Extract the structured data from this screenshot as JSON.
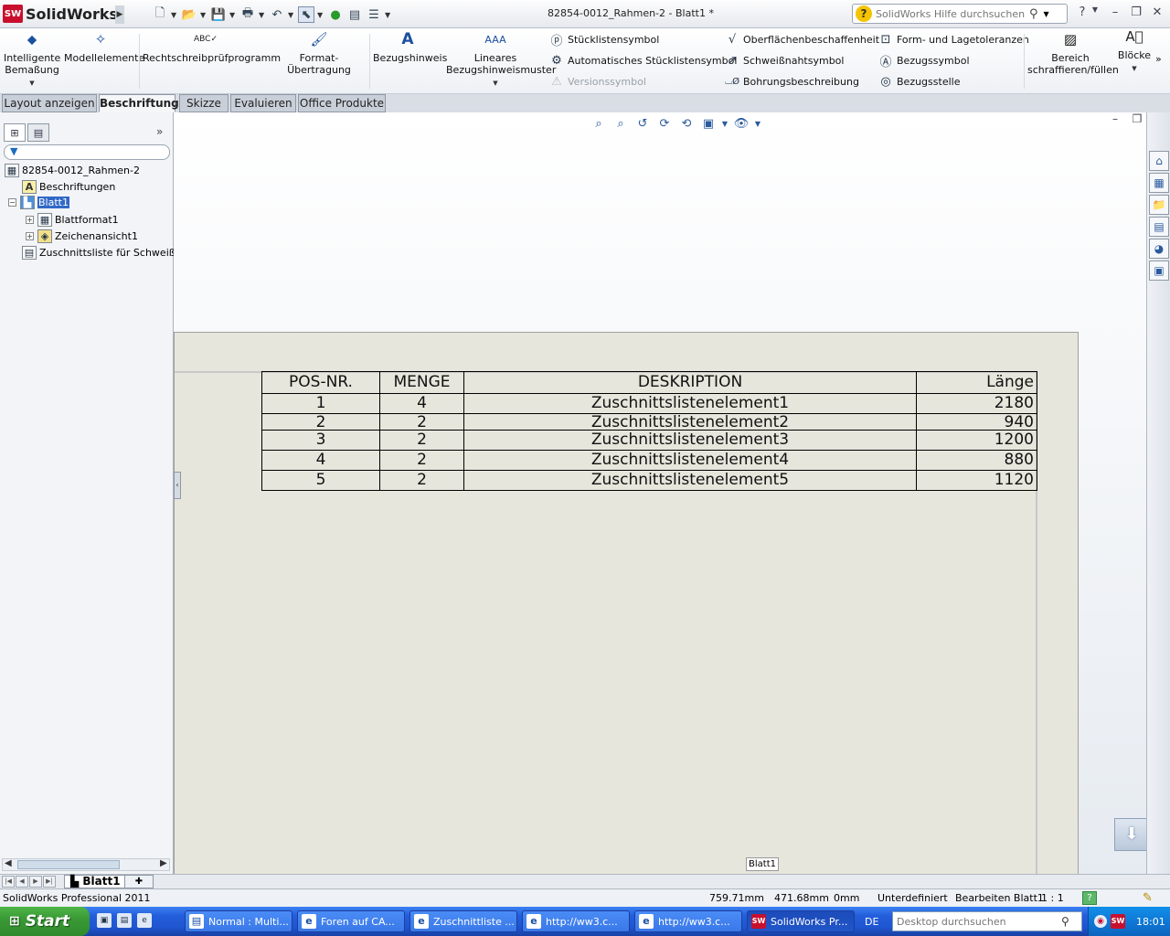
{
  "app": {
    "name_bold": "Solid",
    "name_rest": "Works",
    "logo_text": "SW",
    "doc_title": "82854-0012_Rahmen-2 - Blatt1 *",
    "help_search_placeholder": "SolidWorks Hilfe durchsuchen"
  },
  "ribbon": {
    "large_buttons": [
      {
        "label1": "Intelligente",
        "label2": "Bemaßung",
        "icon": "smart-dimension-icon"
      },
      {
        "label1": "Modellelemente",
        "label2": "",
        "icon": "model-items-icon"
      },
      {
        "label1": "Rechtschreibprüfprogramm",
        "label2": "",
        "icon": "spell-check-icon"
      },
      {
        "label1": "Format-Übertragung",
        "label2": "",
        "icon": "format-painter-icon"
      },
      {
        "label1": "Bezugshinweis",
        "label2": "",
        "icon": "note-icon"
      },
      {
        "label1": "Lineares",
        "label2": "Bezugshinweismuster",
        "icon": "linear-note-pattern-icon"
      }
    ],
    "small_buttons": [
      {
        "label": "Stücklistensymbol",
        "icon": "balloon-icon",
        "disabled": false
      },
      {
        "label": "Automatisches Stücklistensymbol",
        "icon": "auto-balloon-icon",
        "disabled": false
      },
      {
        "label": "Versionssymbol",
        "icon": "revision-symbol-icon",
        "disabled": true
      },
      {
        "label": "Oberflächenbeschaffenheit",
        "icon": "surface-finish-icon",
        "disabled": false
      },
      {
        "label": "Schweißnahtsymbol",
        "icon": "weld-symbol-icon",
        "disabled": false
      },
      {
        "label": "Bohrungsbeschreibung",
        "icon": "hole-callout-icon",
        "disabled": false
      },
      {
        "label": "Form- und Lagetoleranzen",
        "icon": "geometric-tolerance-icon",
        "disabled": false
      },
      {
        "label": "Bezugssymbol",
        "icon": "datum-feature-icon",
        "disabled": false
      },
      {
        "label": "Bezugsstelle",
        "icon": "datum-target-icon",
        "disabled": false
      }
    ],
    "hatch_label1": "Bereich",
    "hatch_label2": "schraffieren/füllen",
    "blocks_label": "Blöcke"
  },
  "tabs": [
    "Layout anzeigen",
    "Beschriftung",
    "Skizze",
    "Evaluieren",
    "Office Produkte"
  ],
  "active_tab": "Beschriftung",
  "tree": {
    "root": "82854-0012_Rahmen-2",
    "annotations": "Beschriftungen",
    "sheet": "Blatt1",
    "sheet_format": "Blattformat1",
    "drawing_view": "Zeichenansicht1",
    "cutlist": "Zuschnittsliste für Schweißkor"
  },
  "table": {
    "headers": [
      "POS-NR.",
      "MENGE",
      "DESKRIPTION",
      "Länge"
    ],
    "rows": [
      [
        "1",
        "4",
        "Zuschnittslistenelement1",
        "2180"
      ],
      [
        "2",
        "2",
        "Zuschnittslistenelement2",
        "940"
      ],
      [
        "3",
        "2",
        "Zuschnittslistenelement3",
        "1200"
      ],
      [
        "4",
        "2",
        "Zuschnittslistenelement4",
        "880"
      ],
      [
        "5",
        "2",
        "Zuschnittslistenelement5",
        "1120"
      ]
    ]
  },
  "sheet_label": "Blatt1",
  "sheet_tab": "Blatt1",
  "status": {
    "product": "SolidWorks Professional 2011",
    "x": "759.71mm",
    "y": "471.68mm",
    "z": "0mm",
    "state": "Unterdefiniert",
    "editing": "Bearbeiten Blatt1",
    "scale": "1 : 1",
    "help": "?"
  },
  "taskbar": {
    "start": "Start",
    "tasks": [
      {
        "label": "Normal : Multi...",
        "icon": "document-icon"
      },
      {
        "label": "Foren auf CA...",
        "icon": "ie-icon"
      },
      {
        "label": "Zuschnittliste ...",
        "icon": "ie-icon"
      },
      {
        "label": "http://ww3.c...",
        "icon": "ie-icon"
      },
      {
        "label": "http://ww3.c...",
        "icon": "ie-icon"
      },
      {
        "label": "SolidWorks Pr...",
        "icon": "solidworks-icon"
      }
    ],
    "lang": "DE",
    "search_placeholder": "Desktop durchsuchen",
    "clock": "18:01"
  }
}
